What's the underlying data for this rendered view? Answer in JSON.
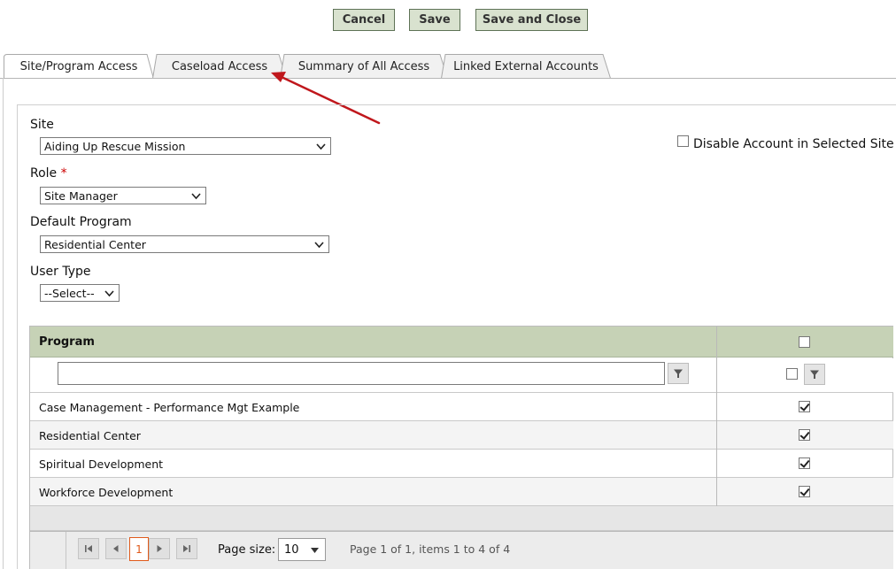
{
  "toolbar": {
    "cancel": "Cancel",
    "save": "Save",
    "save_close": "Save and Close"
  },
  "tabs": [
    {
      "label": "Site/Program Access",
      "active": true
    },
    {
      "label": "Caseload Access",
      "active": false
    },
    {
      "label": "Summary of All Access",
      "active": false
    },
    {
      "label": "Linked External Accounts",
      "active": false
    }
  ],
  "form": {
    "site_label": "Site",
    "site_value": "Aiding Up Rescue Mission",
    "role_label": "Role",
    "role_required": "*",
    "role_value": "Site Manager",
    "default_program_label": "Default Program",
    "default_program_value": "Residential Center",
    "user_type_label": "User Type",
    "user_type_value": "--Select--",
    "disable_account_label": "Disable Account in Selected Site"
  },
  "grid": {
    "column_program": "Program",
    "rows": [
      {
        "program": "Case Management - Performance Mgt Example",
        "checked": true
      },
      {
        "program": "Residential Center",
        "checked": true
      },
      {
        "program": "Spiritual Development",
        "checked": true
      },
      {
        "program": "Workforce Development",
        "checked": true
      }
    ]
  },
  "pager": {
    "current_page": "1",
    "page_size_label": "Page size:",
    "page_size_value": "10",
    "info": "Page 1 of 1, items 1 to 4 of 4"
  },
  "colors": {
    "button_bg": "#d9e2cf",
    "header_bg": "#c6d2b6",
    "arrow": "#c0171c",
    "pager_current": "#e05a1b"
  },
  "icons": [
    "chevron-down-icon",
    "filter-icon",
    "first-page-icon",
    "prev-page-icon",
    "next-page-icon",
    "last-page-icon",
    "arrow-annotation"
  ]
}
